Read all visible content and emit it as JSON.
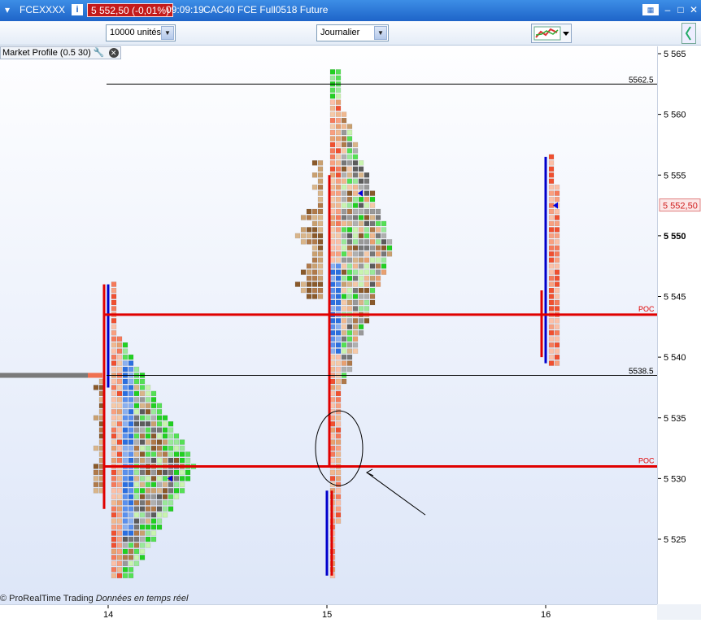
{
  "window": {
    "instrument": "FCEXXXX",
    "price_change": "5 552,50 (-0,01%)",
    "time": "09:09:19",
    "description": "CAC40 FCE Full0518 Future"
  },
  "toolbar": {
    "units_select": "10000 unités",
    "period_select": "Journalier"
  },
  "indicator": {
    "label": "Market Profile (0.5 30)"
  },
  "footer": {
    "brand": "© ProRealTime Trading",
    "realtime": "Données en temps réel"
  },
  "colors": {
    "poc_line": "#e00000",
    "price_marker": "#d02020",
    "titlebar": "#1e64c8"
  },
  "chart_data": {
    "type": "market-profile",
    "y_ticks": [
      "5 565",
      "5 560",
      "5 555",
      "5 550",
      "5 545",
      "5 540",
      "5 535",
      "5 530",
      "5 525"
    ],
    "y_tick_values": [
      5565,
      5560,
      5555,
      5550,
      5545,
      5540,
      5535,
      5530,
      5525
    ],
    "y_bold_tick": "5 550",
    "x_ticks": [
      "14",
      "15",
      "16"
    ],
    "current_price_label": "5 552,50",
    "current_price": 5552.5,
    "ylim": [
      5521.5,
      5566.5
    ],
    "horizontal_levels": [
      {
        "label": "5562.5",
        "value": 5562.5
      },
      {
        "label": "5538.5",
        "value": 5538.5
      }
    ],
    "poc_lines": [
      {
        "label": "POC",
        "value": 5543.5
      },
      {
        "label": "POC",
        "value": 5531.0
      }
    ],
    "profiles": [
      {
        "day": "14",
        "low": 5522.0,
        "high": 5546.0,
        "poc": 5531.0
      },
      {
        "day": "15",
        "low": 5522.0,
        "high": 5563.5,
        "poc": 5543.5
      },
      {
        "day": "16",
        "low": 5539.5,
        "high": 5556.5,
        "poc": 5543.5
      }
    ]
  }
}
